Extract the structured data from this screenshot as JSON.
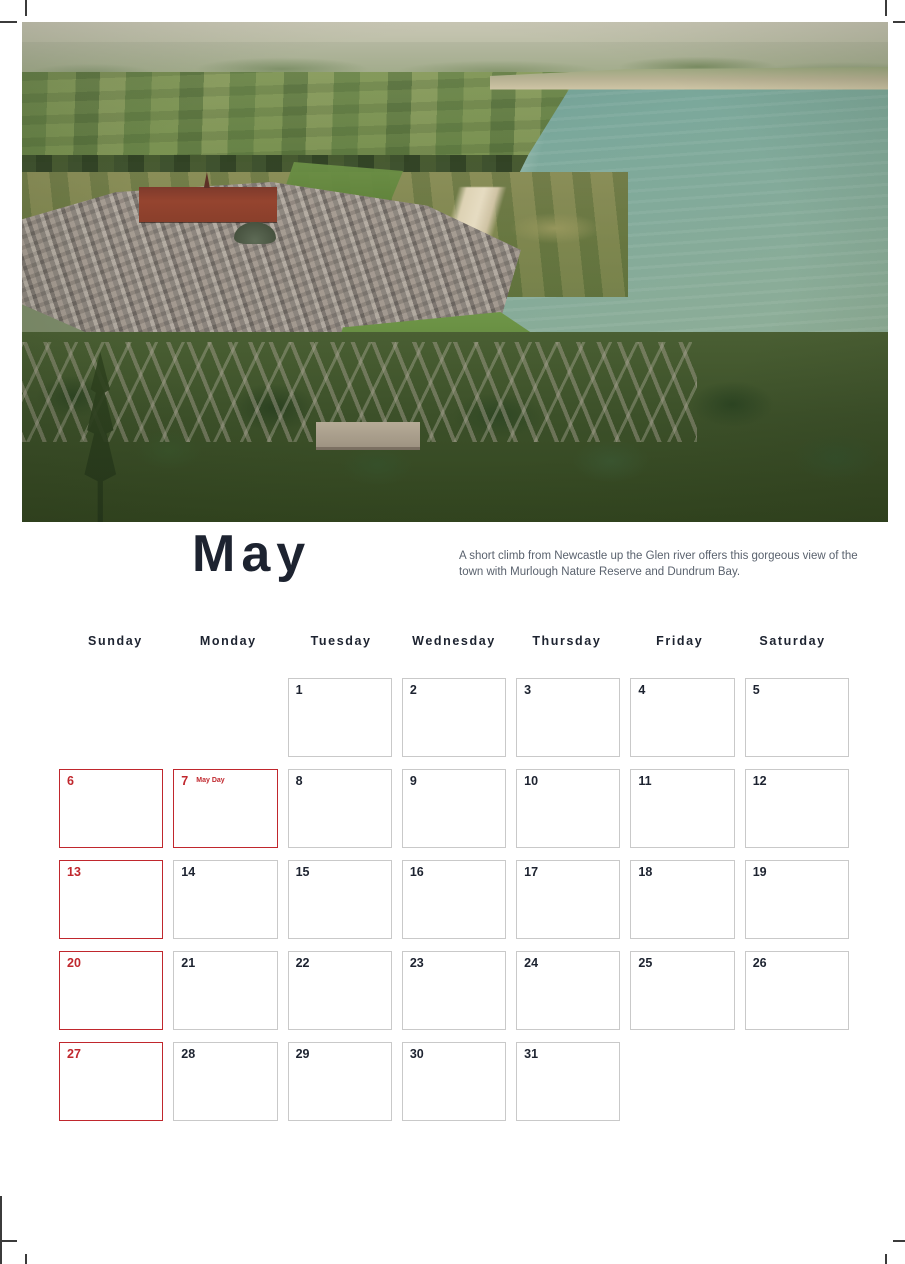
{
  "page": {
    "month_title": "May",
    "description": "A short climb from Newcastle up the Glen river offers this gorgeous view of the town with Murlough Nature Reserve and Dundrum Bay.",
    "photo_alt": "Aerial view of Newcastle town, Murlough Nature Reserve and Dundrum Bay"
  },
  "colors": {
    "holiday": "#c0272d",
    "text_dark": "#1d2330",
    "text_muted": "#5a626e",
    "cell_border": "#c9c9c9"
  },
  "weekdays": [
    "Sunday",
    "Monday",
    "Tuesday",
    "Wednesday",
    "Thursday",
    "Friday",
    "Saturday"
  ],
  "weeks": [
    [
      {
        "day": "",
        "empty": true
      },
      {
        "day": "",
        "empty": true
      },
      {
        "day": "1",
        "holiday": false,
        "event": ""
      },
      {
        "day": "2",
        "holiday": false,
        "event": ""
      },
      {
        "day": "3",
        "holiday": false,
        "event": ""
      },
      {
        "day": "4",
        "holiday": false,
        "event": ""
      },
      {
        "day": "5",
        "holiday": false,
        "event": ""
      }
    ],
    [
      {
        "day": "6",
        "holiday": true,
        "event": ""
      },
      {
        "day": "7",
        "holiday": true,
        "event": "May Day"
      },
      {
        "day": "8",
        "holiday": false,
        "event": ""
      },
      {
        "day": "9",
        "holiday": false,
        "event": ""
      },
      {
        "day": "10",
        "holiday": false,
        "event": ""
      },
      {
        "day": "11",
        "holiday": false,
        "event": ""
      },
      {
        "day": "12",
        "holiday": false,
        "event": ""
      }
    ],
    [
      {
        "day": "13",
        "holiday": true,
        "event": ""
      },
      {
        "day": "14",
        "holiday": false,
        "event": ""
      },
      {
        "day": "15",
        "holiday": false,
        "event": ""
      },
      {
        "day": "16",
        "holiday": false,
        "event": ""
      },
      {
        "day": "17",
        "holiday": false,
        "event": ""
      },
      {
        "day": "18",
        "holiday": false,
        "event": ""
      },
      {
        "day": "19",
        "holiday": false,
        "event": ""
      }
    ],
    [
      {
        "day": "20",
        "holiday": true,
        "event": ""
      },
      {
        "day": "21",
        "holiday": false,
        "event": ""
      },
      {
        "day": "22",
        "holiday": false,
        "event": ""
      },
      {
        "day": "23",
        "holiday": false,
        "event": ""
      },
      {
        "day": "24",
        "holiday": false,
        "event": ""
      },
      {
        "day": "25",
        "holiday": false,
        "event": ""
      },
      {
        "day": "26",
        "holiday": false,
        "event": ""
      }
    ],
    [
      {
        "day": "27",
        "holiday": true,
        "event": ""
      },
      {
        "day": "28",
        "holiday": false,
        "event": ""
      },
      {
        "day": "29",
        "holiday": false,
        "event": ""
      },
      {
        "day": "30",
        "holiday": false,
        "event": ""
      },
      {
        "day": "31",
        "holiday": false,
        "event": ""
      },
      {
        "day": "",
        "empty": true
      },
      {
        "day": "",
        "empty": true
      }
    ]
  ]
}
